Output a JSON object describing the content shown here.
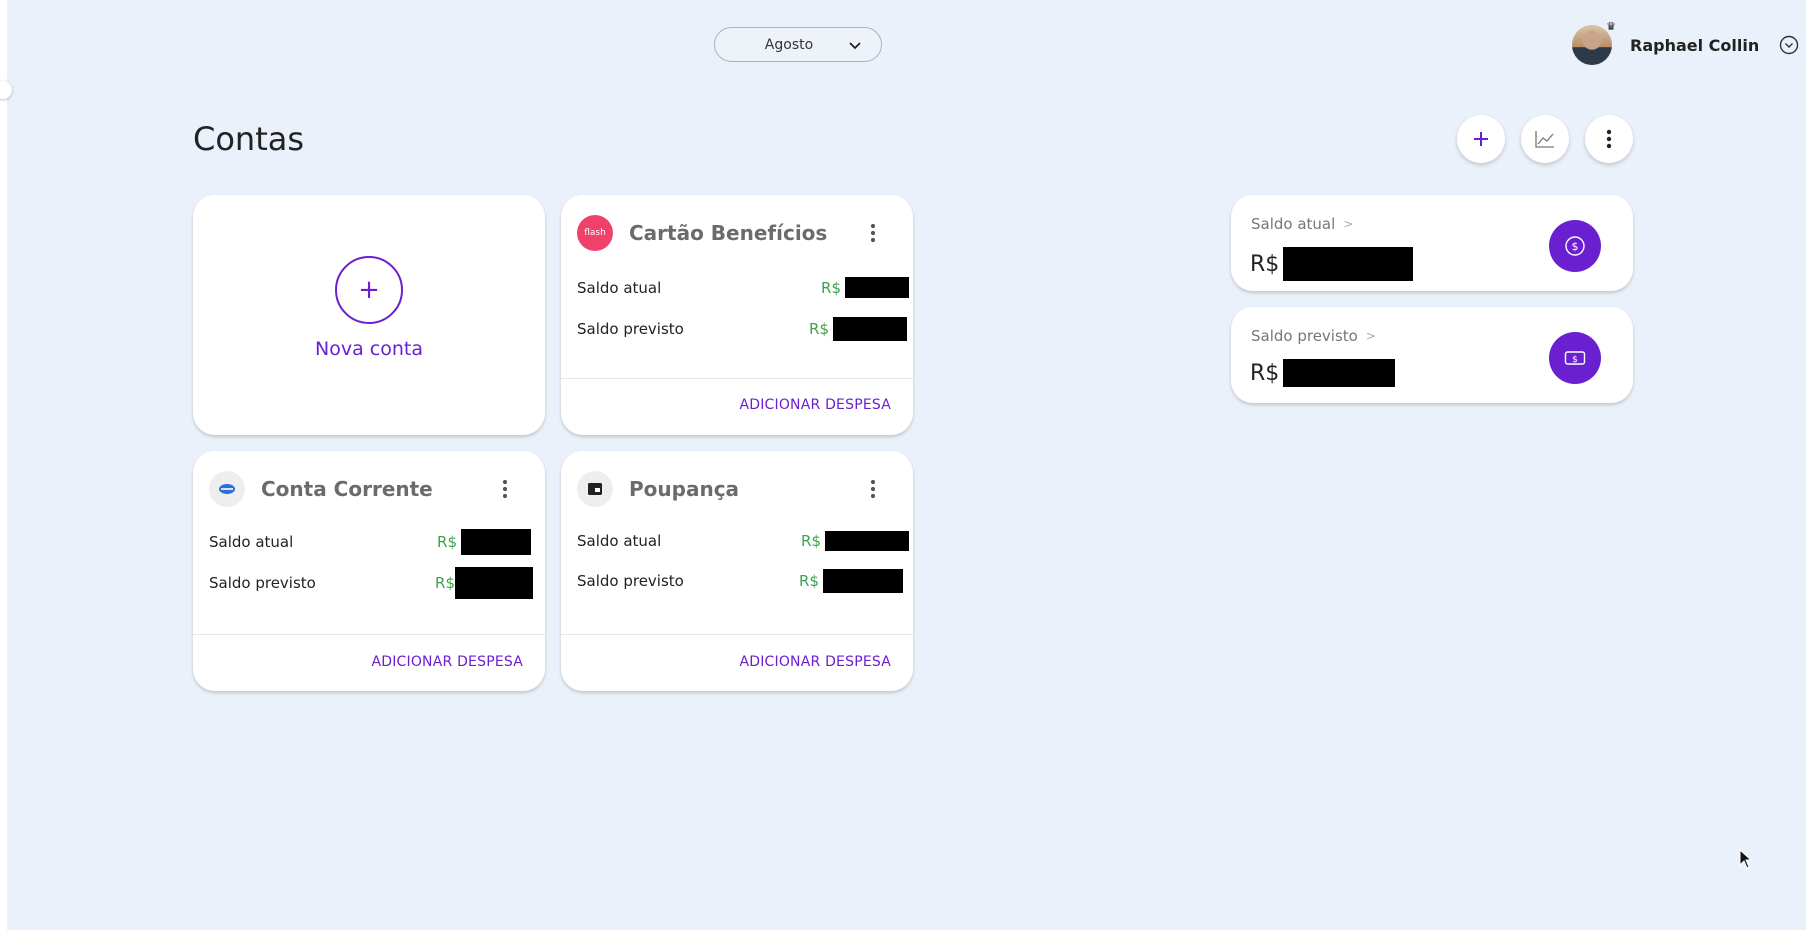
{
  "header": {
    "month": "Agosto",
    "user_name": "Raphael Collin"
  },
  "page": {
    "title": "Contas"
  },
  "toolbar": {
    "add_icon": "plus-icon",
    "chart_icon": "line-chart-icon",
    "more_icon": "kebab-icon"
  },
  "new_account": {
    "label": "Nova conta"
  },
  "accounts": [
    {
      "name": "Cartão Benefícios",
      "logo_text": "flash",
      "logo_color": "#f0416a",
      "saldo_atual_label": "Saldo atual",
      "saldo_previsto_label": "Saldo previsto",
      "currency": "R$",
      "action": "ADICIONAR DESPESA"
    },
    {
      "name": "Conta Corrente",
      "logo_text": "",
      "logo_color": "#eeeeee",
      "saldo_atual_label": "Saldo atual",
      "saldo_previsto_label": "Saldo previsto",
      "currency": "R$",
      "action": "ADICIONAR DESPESA"
    },
    {
      "name": "Poupança",
      "logo_text": "",
      "logo_color": "#eeeeee",
      "saldo_atual_label": "Saldo atual",
      "saldo_previsto_label": "Saldo previsto",
      "currency": "R$",
      "action": "ADICIONAR DESPESA"
    }
  ],
  "summary": {
    "saldo_atual_label": "Saldo atual",
    "saldo_previsto_label": "Saldo previsto",
    "currency": "R$",
    "accent": "#6a1fd0"
  },
  "colors": {
    "accent": "#6a1fd0",
    "positive": "#3fa34d",
    "background": "#eaf1fa"
  }
}
